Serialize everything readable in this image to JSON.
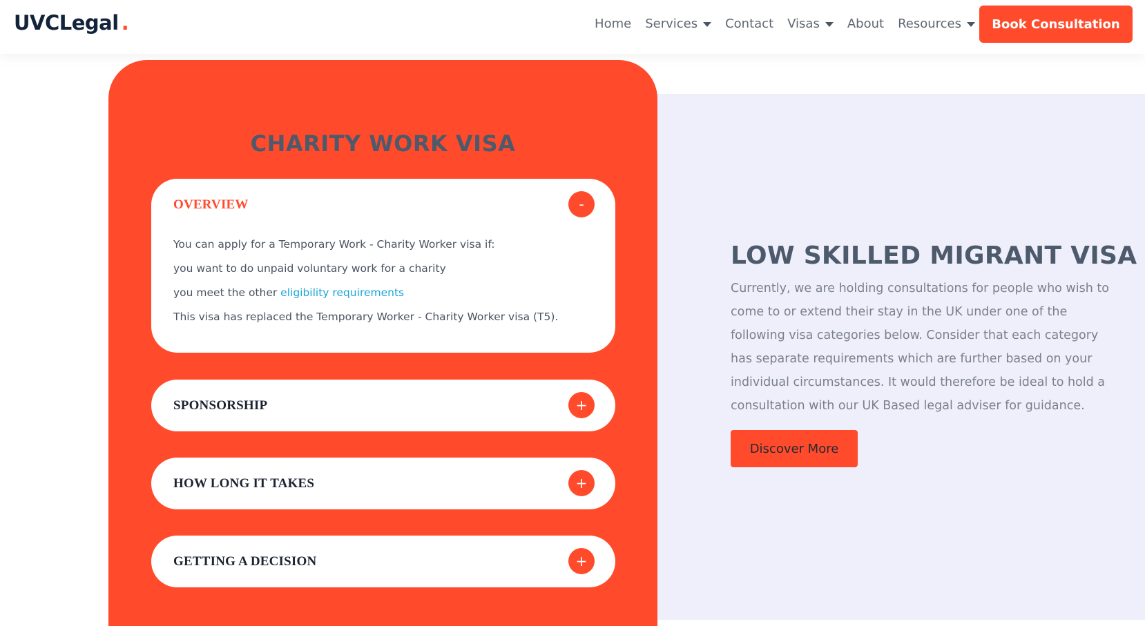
{
  "header": {
    "logo_text": "UVCLegal",
    "logo_dot": ".",
    "nav": [
      {
        "label": "Home",
        "dropdown": false
      },
      {
        "label": "Services",
        "dropdown": true
      },
      {
        "label": "Contact",
        "dropdown": false
      },
      {
        "label": "Visas",
        "dropdown": true
      },
      {
        "label": "About",
        "dropdown": false
      },
      {
        "label": "Resources",
        "dropdown": true
      }
    ],
    "cta_label": "Book Consultation"
  },
  "card": {
    "title": "CHARITY WORK VISA",
    "accordion": [
      {
        "heading": "OVERVIEW",
        "expanded": true,
        "toggle_symbol": "-",
        "lines": {
          "line1": "You can apply for a Temporary Work - Charity Worker visa if:",
          "line2": "you want to do unpaid voluntary work for a charity",
          "line3_prefix": "you meet the other ",
          "line3_link": "eligibility requirements",
          "line4": "This visa has replaced the Temporary Worker - Charity Worker visa (T5)."
        }
      },
      {
        "heading": "SPONSORSHIP",
        "expanded": false,
        "toggle_symbol": "+"
      },
      {
        "heading": "HOW LONG IT TAKES",
        "expanded": false,
        "toggle_symbol": "+"
      },
      {
        "heading": "GETTING A DECISION",
        "expanded": false,
        "toggle_symbol": "+"
      }
    ]
  },
  "side": {
    "title": "LOW SKILLED MIGRANT VISA",
    "paragraph": "Currently, we are holding consultations for people who wish to come to or extend their stay in the UK under one of the following visa categories below. Consider that each category has separate requirements which are further based on your individual circumstances. It would therefore be ideal to hold a consultation with our UK Based legal adviser for guidance.",
    "button_label": "Discover More"
  },
  "colors": {
    "accent": "#ff4b2b",
    "panel_bg": "#efeffb",
    "heading": "#4c5a6b",
    "link": "#1aa6d8"
  }
}
